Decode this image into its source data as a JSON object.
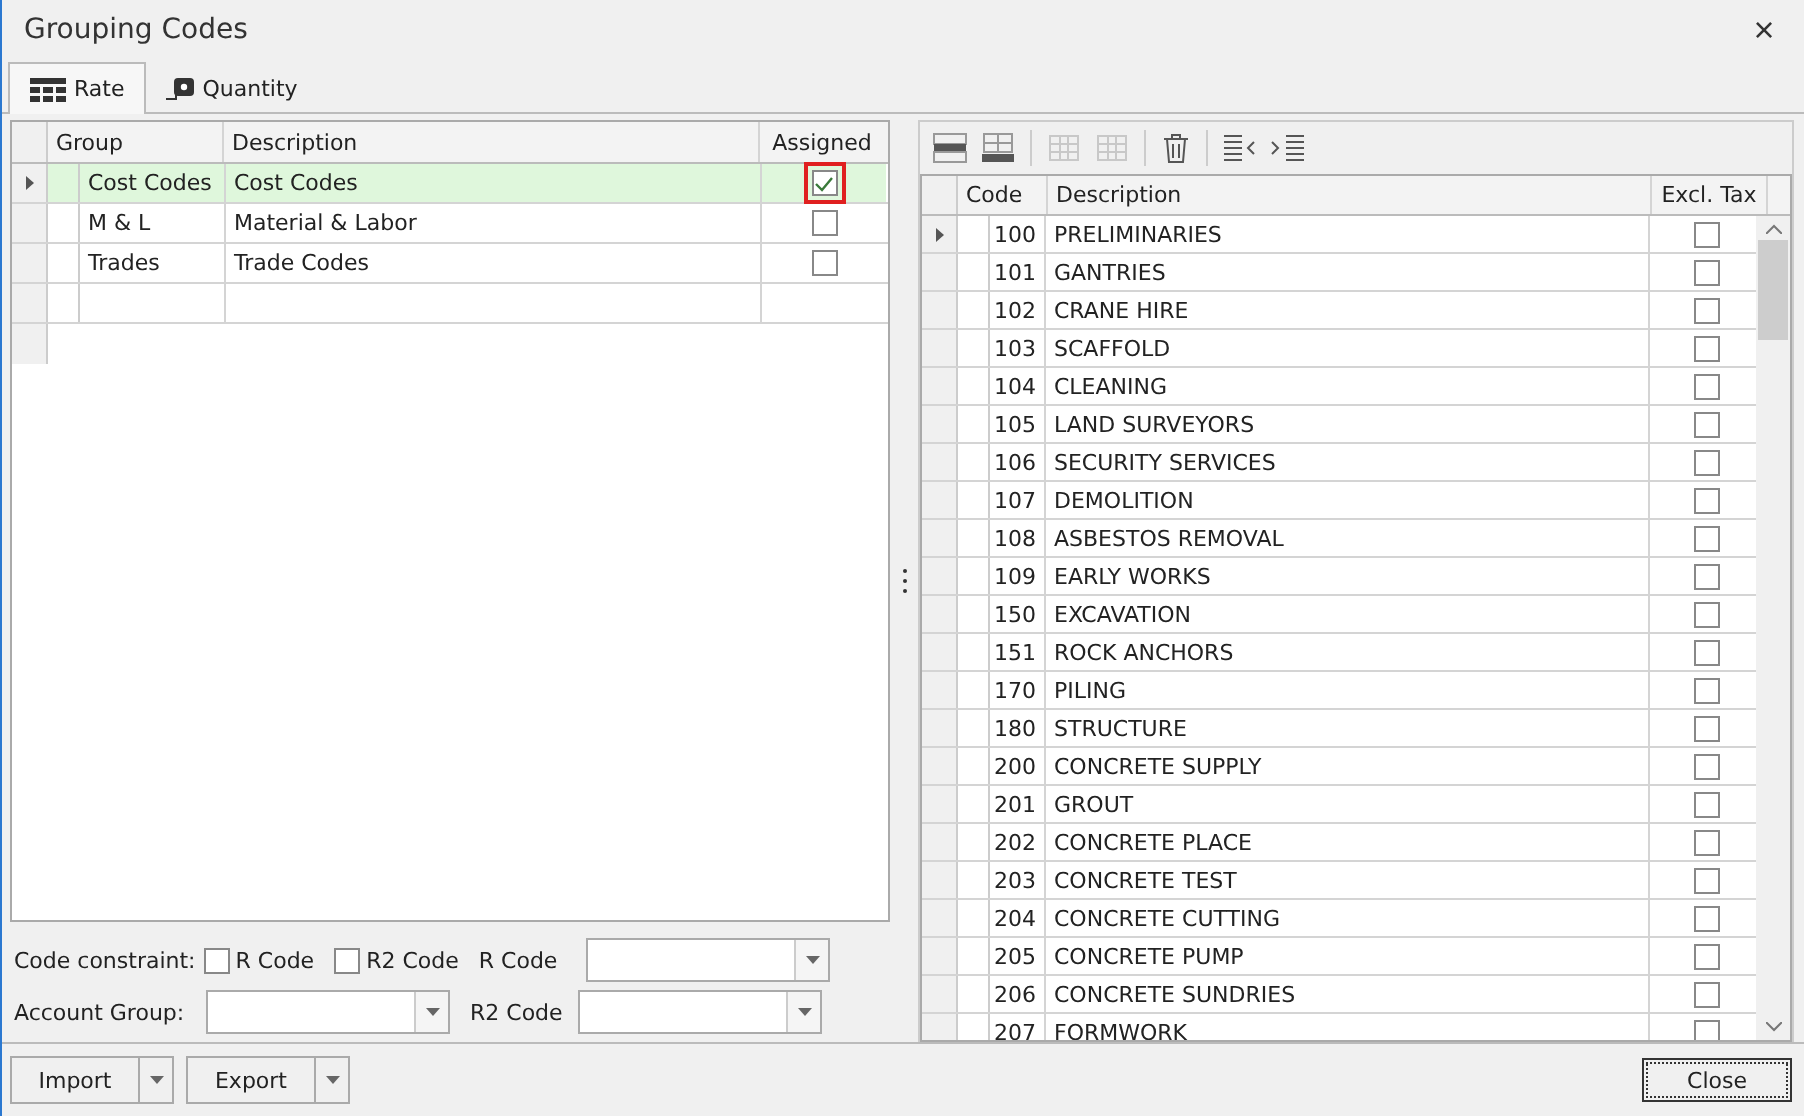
{
  "window": {
    "title": "Grouping Codes",
    "close": "×"
  },
  "tabs": [
    {
      "label": "Rate",
      "selected": true
    },
    {
      "label": "Quantity",
      "selected": false
    }
  ],
  "groups": {
    "columns": [
      "Group",
      "Description",
      "Assigned"
    ],
    "rows": [
      {
        "group": "Cost Codes",
        "description": "Cost Codes",
        "assigned": true,
        "selected": true
      },
      {
        "group": "M & L",
        "description": "Material & Labor",
        "assigned": false,
        "selected": false
      },
      {
        "group": "Trades",
        "description": "Trade Codes",
        "assigned": false,
        "selected": false
      }
    ]
  },
  "filters": {
    "code_constraint_label": "Code constraint:",
    "r_code_check": {
      "label": "R Code",
      "checked": false
    },
    "r2_code_check": {
      "label": "R2 Code",
      "checked": false
    },
    "r_code_label": "R Code",
    "r2_code_label": "R2 Code",
    "account_group_label": "Account Group:"
  },
  "toolbar": [
    {
      "kind": "insert-row",
      "disabled": false
    },
    {
      "kind": "append-row",
      "disabled": false
    },
    {
      "kind": "sep"
    },
    {
      "kind": "grid",
      "disabled": true
    },
    {
      "kind": "grid",
      "disabled": true
    },
    {
      "kind": "sep"
    },
    {
      "kind": "trash",
      "disabled": false
    },
    {
      "kind": "sep"
    },
    {
      "kind": "outdent",
      "disabled": false
    },
    {
      "kind": "indent",
      "disabled": false
    }
  ],
  "codes": {
    "columns": [
      "Code",
      "Description",
      "Excl. Tax"
    ],
    "rows": [
      {
        "code": "100",
        "description": "PRELIMINARIES",
        "excl_tax": false,
        "selected": true
      },
      {
        "code": "101",
        "description": "GANTRIES",
        "excl_tax": false,
        "selected": false
      },
      {
        "code": "102",
        "description": "CRANE HIRE",
        "excl_tax": false,
        "selected": false
      },
      {
        "code": "103",
        "description": "SCAFFOLD",
        "excl_tax": false,
        "selected": false
      },
      {
        "code": "104",
        "description": "CLEANING",
        "excl_tax": false,
        "selected": false
      },
      {
        "code": "105",
        "description": "LAND SURVEYORS",
        "excl_tax": false,
        "selected": false
      },
      {
        "code": "106",
        "description": "SECURITY SERVICES",
        "excl_tax": false,
        "selected": false
      },
      {
        "code": "107",
        "description": "DEMOLITION",
        "excl_tax": false,
        "selected": false
      },
      {
        "code": "108",
        "description": "ASBESTOS REMOVAL",
        "excl_tax": false,
        "selected": false
      },
      {
        "code": "109",
        "description": "EARLY WORKS",
        "excl_tax": false,
        "selected": false
      },
      {
        "code": "150",
        "description": "EXCAVATION",
        "excl_tax": false,
        "selected": false
      },
      {
        "code": "151",
        "description": "ROCK ANCHORS",
        "excl_tax": false,
        "selected": false
      },
      {
        "code": "170",
        "description": "PILING",
        "excl_tax": false,
        "selected": false
      },
      {
        "code": "180",
        "description": "STRUCTURE",
        "excl_tax": false,
        "selected": false
      },
      {
        "code": "200",
        "description": "CONCRETE SUPPLY",
        "excl_tax": false,
        "selected": false
      },
      {
        "code": "201",
        "description": "GROUT",
        "excl_tax": false,
        "selected": false
      },
      {
        "code": "202",
        "description": "CONCRETE PLACE",
        "excl_tax": false,
        "selected": false
      },
      {
        "code": "203",
        "description": "CONCRETE TEST",
        "excl_tax": false,
        "selected": false
      },
      {
        "code": "204",
        "description": "CONCRETE CUTTING",
        "excl_tax": false,
        "selected": false
      },
      {
        "code": "205",
        "description": "CONCRETE PUMP",
        "excl_tax": false,
        "selected": false
      },
      {
        "code": "206",
        "description": "CONCRETE SUNDRIES",
        "excl_tax": false,
        "selected": false
      },
      {
        "code": "207",
        "description": "FORMWORK",
        "excl_tax": false,
        "selected": false
      }
    ]
  },
  "buttons": {
    "import": "Import",
    "export": "Export",
    "close": "Close"
  }
}
